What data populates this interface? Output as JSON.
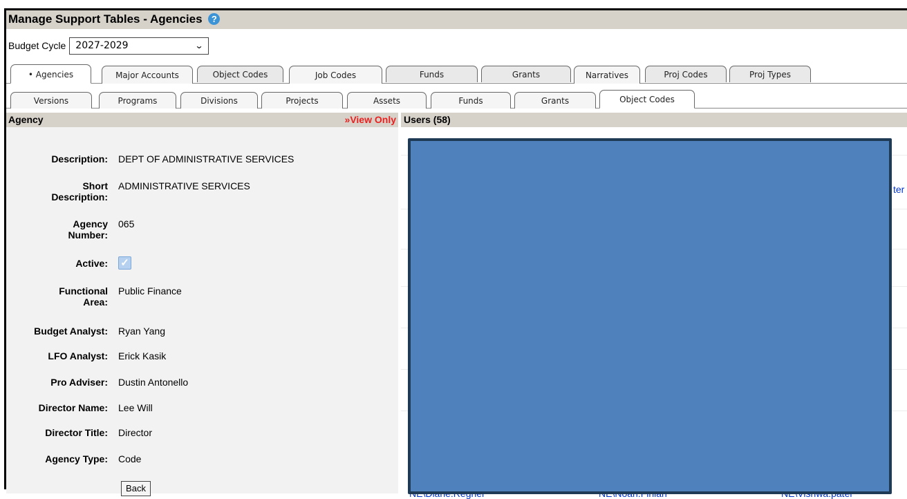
{
  "header": {
    "title": "Manage Support Tables - Agencies",
    "help_icon": "?"
  },
  "budget_cycle": {
    "label": "Budget Cycle",
    "selected": "2027-2029"
  },
  "tabs_row1": [
    {
      "label": "• Agencies",
      "active": true
    },
    {
      "label": "Major Accounts"
    },
    {
      "label": "Object Codes"
    },
    {
      "label": "Job Codes"
    },
    {
      "label": "Funds"
    },
    {
      "label": "Grants"
    },
    {
      "label": "Narratives"
    },
    {
      "label": "Proj Codes"
    },
    {
      "label": "Proj Types"
    }
  ],
  "tabs_row2": [
    {
      "label": "Versions"
    },
    {
      "label": "Programs"
    },
    {
      "label": "Divisions"
    },
    {
      "label": "Projects"
    },
    {
      "label": "Assets"
    },
    {
      "label": "Funds"
    },
    {
      "label": "Grants"
    },
    {
      "label": "Object Codes",
      "active": true
    }
  ],
  "agency_panel": {
    "title": "Agency",
    "view_only": "»View Only",
    "fields": {
      "description": {
        "label": "Description:",
        "value": "DEPT OF ADMINISTRATIVE SERVICES"
      },
      "short_description": {
        "label1": "Short",
        "label2": "Description:",
        "value": "ADMINISTRATIVE SERVICES"
      },
      "agency_number": {
        "label1": "Agency",
        "label2": "Number:",
        "value": "065"
      },
      "active": {
        "label": "Active:",
        "checked": true
      },
      "functional_area": {
        "label1": "Functional",
        "label2": "Area:",
        "value": "Public Finance"
      },
      "budget_analyst": {
        "label": "Budget Analyst:",
        "value": "Ryan Yang"
      },
      "lfo_analyst": {
        "label": "LFO Analyst:",
        "value": "Erick Kasik"
      },
      "pro_adviser": {
        "label": "Pro Adviser:",
        "value": "Dustin Antonello"
      },
      "director_name": {
        "label": "Director Name:",
        "value": "Lee Will"
      },
      "director_title": {
        "label": "Director Title:",
        "value": "Director"
      },
      "agency_type": {
        "label": "Agency Type:",
        "value": "Code"
      }
    },
    "back_button": "Back"
  },
  "users_panel": {
    "title": "Users (58)",
    "partial_right": "ter",
    "bottom_row": [
      "NE\\Diane.Regner",
      "NE\\Noah.Finlan",
      "NE\\Vishwa.patel"
    ]
  }
}
